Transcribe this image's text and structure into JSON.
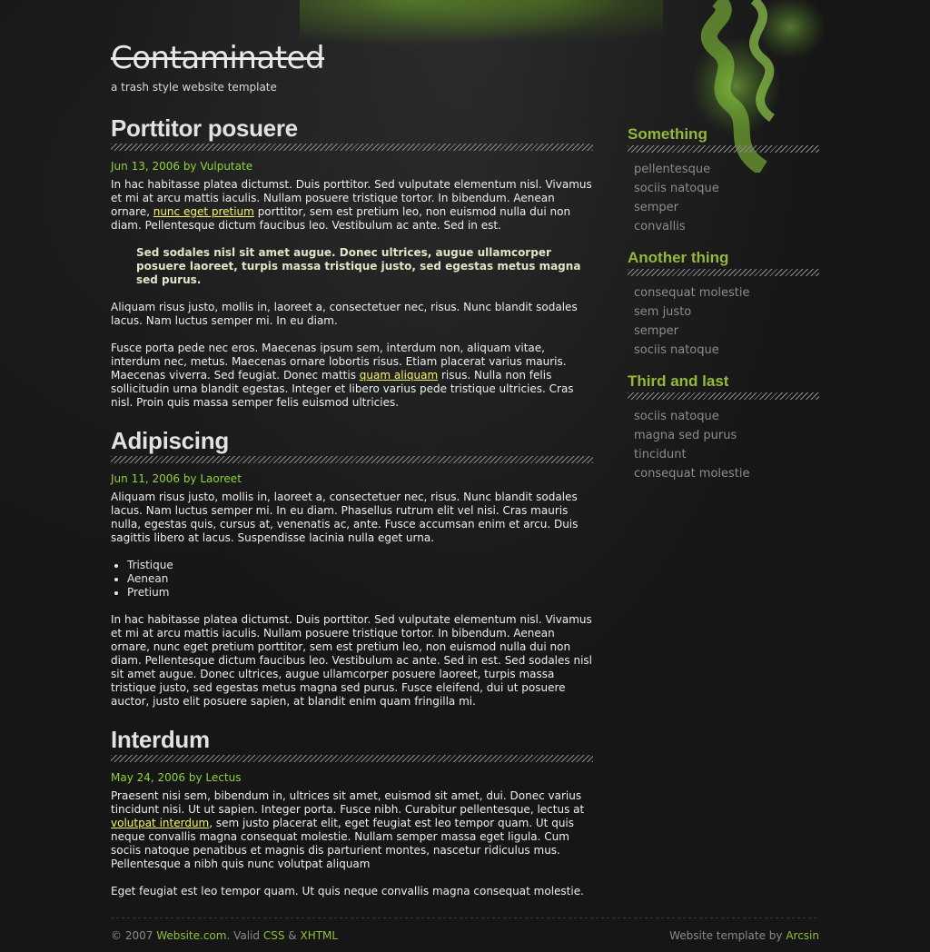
{
  "header": {
    "title": "Contaminated",
    "tagline": "a trash style website template"
  },
  "posts": [
    {
      "title": "Porttitor posuere",
      "date": "Jun 13, 2006 by",
      "author": "Vulputate",
      "p1_a": "In hac habitasse platea dictumst. Duis porttitor. Sed vulputate elementum nisl. Vivamus et mi at arcu mattis iaculis. Nullam posuere tristique tortor. In bibendum. Aenean ornare,",
      "p1_link": "nunc eget pretium",
      "p1_b": "porttitor, sem est pretium leo, non euismod nulla dui non diam. Pellentesque dictum faucibus leo. Vestibulum ac ante. Sed in est.",
      "quote": "Sed sodales nisl sit amet augue. Donec ultrices, augue ullamcorper posuere laoreet, turpis massa tristique justo, sed egestas metus magna sed purus.",
      "p2": "Aliquam risus justo, mollis in, laoreet a, consectetuer nec, risus. Nunc blandit sodales lacus. Nam luctus semper mi. In eu diam.",
      "p3_a": "Fusce porta pede nec eros. Maecenas ipsum sem, interdum non, aliquam vitae, interdum nec, metus. Maecenas ornare lobortis risus. Etiam placerat varius mauris. Maecenas viverra. Sed feugiat. Donec mattis",
      "p3_link": "quam aliquam",
      "p3_b": "risus. Nulla non felis sollicitudin urna blandit egestas. Integer et libero varius pede tristique ultricies. Cras nisl. Proin quis massa semper felis euismod ultricies."
    },
    {
      "title": "Adipiscing",
      "date": "Jun 11, 2006 by",
      "author": "Laoreet",
      "p1": "Aliquam risus justo, mollis in, laoreet a, consectetuer nec, risus. Nunc blandit sodales lacus. Nam luctus semper mi. In eu diam. Phasellus rutrum elit vel nisi. Cras mauris nulla, egestas quis, cursus at, venenatis ac, ante. Fusce accumsan enim et arcu. Duis sagittis libero at lacus. Suspendisse lacinia nulla eget urna.",
      "list": [
        "Tristique",
        "Aenean",
        "Pretium"
      ],
      "p2": "In hac habitasse platea dictumst. Duis porttitor. Sed vulputate elementum nisl. Vivamus et mi at arcu mattis iaculis. Nullam posuere tristique tortor. In bibendum. Aenean ornare, nunc eget pretium porttitor, sem est pretium leo, non euismod nulla dui non diam. Pellentesque dictum faucibus leo. Vestibulum ac ante. Sed in est. Sed sodales nisl sit amet augue. Donec ultrices, augue ullamcorper posuere laoreet, turpis massa tristique justo, sed egestas metus magna sed purus. Fusce eleifend, dui ut posuere auctor, justo elit posuere sapien, at blandit enim quam fringilla mi."
    },
    {
      "title": "Interdum",
      "date": "May 24, 2006 by",
      "author": "Lectus",
      "p1_a": "Praesent nisi sem, bibendum in, ultrices sit amet, euismod sit amet, dui. Donec varius tincidunt nisi. Ut ut sapien. Integer porta. Fusce nibh. Curabitur pellentesque, lectus at",
      "p1_link": "volutpat interdum",
      "p1_b": ", sem justo placerat elit, eget feugiat est leo tempor quam. Ut quis neque convallis magna consequat molestie. Nullam semper massa eget ligula. Cum sociis natoque penatibus et magnis dis parturient montes, nascetur ridiculus mus. Pellentesque a nibh quis nunc volutpat aliquam",
      "p2": "Eget feugiat est leo tempor quam. Ut quis neque convallis magna consequat molestie."
    }
  ],
  "sidebar": {
    "sections": [
      {
        "title": "Something",
        "items": [
          "pellentesque",
          "sociis natoque",
          "semper",
          "convallis"
        ]
      },
      {
        "title": "Another thing",
        "items": [
          "consequat molestie",
          "sem justo",
          "semper",
          "sociis natoque"
        ]
      },
      {
        "title": "Third and last",
        "items": [
          "sociis natoque",
          "magna sed purus",
          "tincidunt",
          "consequat molestie"
        ]
      }
    ]
  },
  "footer": {
    "copyright": "© 2007",
    "site_link": "Website.com",
    "valid_text": ". Valid",
    "css_link": "CSS",
    "amp": "&",
    "xhtml_link": "XHTML",
    "credit_text": "Website template by",
    "credit_link": "Arcsin"
  },
  "colors": {
    "background": "#161616",
    "accent_green": "#8ed33a",
    "sidebar_heading": "#96b83a",
    "link_yellow": "#f4f46a"
  }
}
